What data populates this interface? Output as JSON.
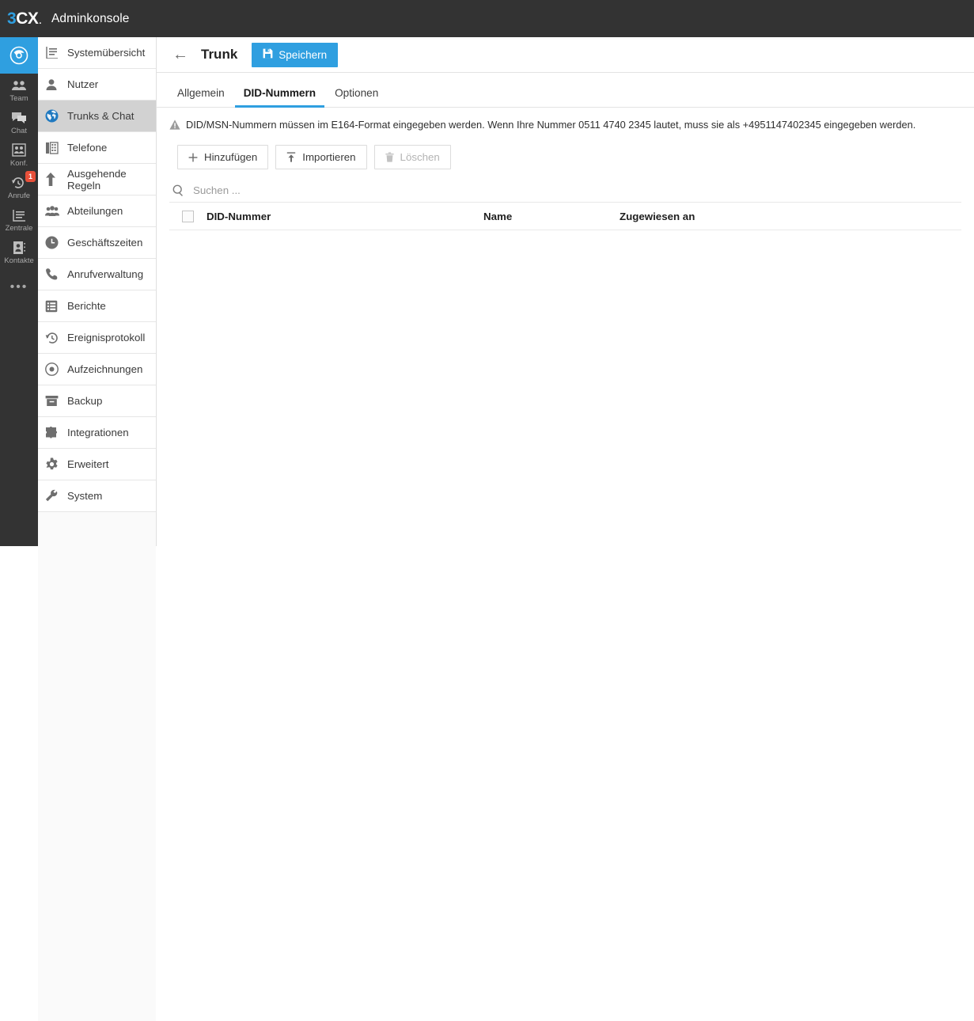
{
  "topbar": {
    "logo_three": "3",
    "logo_cx": "CX",
    "logo_dot": ".",
    "title": "Adminkonsole"
  },
  "rail": {
    "items": [
      {
        "label": "",
        "icon": "chrome-globe-icon",
        "active": true
      },
      {
        "label": "Team",
        "icon": "people-icon"
      },
      {
        "label": "Chat",
        "icon": "chat-bubbles-icon"
      },
      {
        "label": "Konf.",
        "icon": "conference-icon"
      },
      {
        "label": "Anrufe",
        "icon": "call-history-icon",
        "badge": "1"
      },
      {
        "label": "Zentrale",
        "icon": "switchboard-icon"
      },
      {
        "label": "Kontakte",
        "icon": "contacts-icon"
      }
    ],
    "more": "•••"
  },
  "sidebar": {
    "items": [
      {
        "label": "Systemübersicht",
        "icon": "system-overview-icon"
      },
      {
        "label": "Nutzer",
        "icon": "user-icon"
      },
      {
        "label": "Trunks & Chat",
        "icon": "globe-icon",
        "selected": true
      },
      {
        "label": "Telefone",
        "icon": "phones-icon"
      },
      {
        "label": "Ausgehende Regeln",
        "icon": "up-arrow-icon",
        "two_line": true
      },
      {
        "label": "Abteilungen",
        "icon": "departments-icon"
      },
      {
        "label": "Geschäftszeiten",
        "icon": "clock-icon"
      },
      {
        "label": "Anrufverwaltung",
        "icon": "phone-handset-icon"
      },
      {
        "label": "Berichte",
        "icon": "reports-icon"
      },
      {
        "label": "Ereignisprotokoll",
        "icon": "history-icon"
      },
      {
        "label": "Aufzeichnungen",
        "icon": "record-icon"
      },
      {
        "label": "Backup",
        "icon": "archive-icon"
      },
      {
        "label": "Integrationen",
        "icon": "puzzle-icon"
      },
      {
        "label": "Erweitert",
        "icon": "gear-icon"
      },
      {
        "label": "System",
        "icon": "wrench-icon"
      }
    ]
  },
  "page": {
    "back_label": "←",
    "title": "Trunk",
    "save_label": "Speichern"
  },
  "tabs": [
    {
      "label": "Allgemein",
      "active": false
    },
    {
      "label": "DID-Nummern",
      "active": true
    },
    {
      "label": "Optionen",
      "active": false
    }
  ],
  "notice": {
    "text": "DID/MSN-Nummern müssen im E164-Format eingegeben werden. Wenn Ihre Nummer 0511 4740 2345 lautet, muss sie als +4951147402345 eingegeben werden."
  },
  "toolbar": {
    "add_label": "Hinzufügen",
    "import_label": "Importieren",
    "delete_label": "Löschen"
  },
  "search": {
    "placeholder": "Suchen ...",
    "value": ""
  },
  "table": {
    "columns": {
      "did": "DID-Nummer",
      "name": "Name",
      "assigned": "Zugewiesen an"
    },
    "rows": []
  },
  "colors": {
    "accent": "#2f9fe0",
    "topbar": "#333333",
    "selected_nav": "#d2d2d2",
    "badge": "#e8503a"
  }
}
